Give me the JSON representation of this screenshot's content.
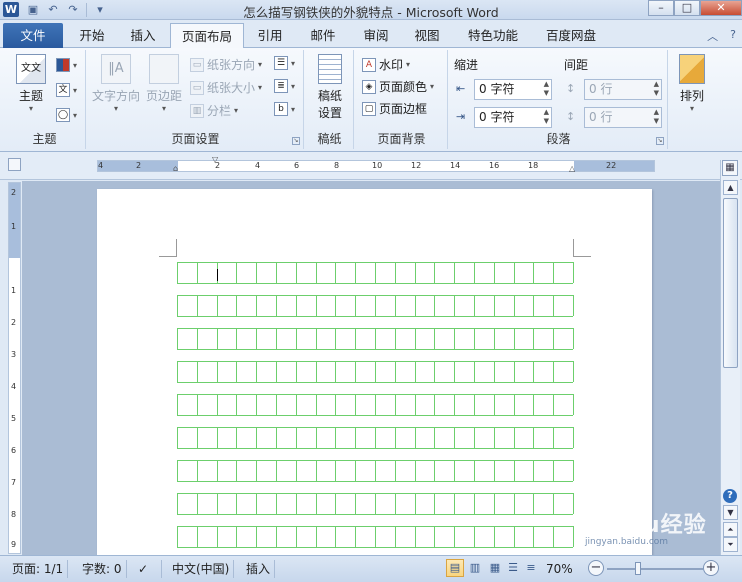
{
  "app": {
    "title": "怎么描写钢铁侠的外貌特点 - Microsoft Word",
    "logo_letter": "W"
  },
  "tabs": {
    "file": "文件",
    "items": [
      "开始",
      "插入",
      "页面布局",
      "引用",
      "邮件",
      "审阅",
      "视图",
      "特色功能",
      "百度网盘"
    ],
    "active": "页面布局"
  },
  "ribbon": {
    "theme": {
      "group_label": "主题",
      "button_label": "主题"
    },
    "page_setup": {
      "group_label": "页面设置",
      "text_direction": "文字方向",
      "margins": "页边距",
      "orientation": "纸张方向",
      "size": "纸张大小",
      "columns": "分栏"
    },
    "draft": {
      "group_label": "稿纸",
      "button_label": "稿纸\n设置",
      "line1": "稿纸",
      "line2": "设置"
    },
    "background": {
      "group_label": "页面背景",
      "watermark": "水印",
      "page_color": "页面颜色",
      "page_borders": "页面边框"
    },
    "paragraph": {
      "group_label": "段落",
      "indent_label": "缩进",
      "spacing_label": "间距",
      "indent_left": "0 字符",
      "indent_right": "0 字符",
      "spacing_before": "0 行",
      "spacing_after": "0 行"
    },
    "arrange": {
      "button_label": "排列"
    }
  },
  "ruler": {
    "h_labels": [
      "4",
      "2",
      "2",
      "4",
      "6",
      "8",
      "10",
      "12",
      "14",
      "16",
      "18",
      "22"
    ],
    "v_labels": [
      "2",
      "1",
      "1",
      "2",
      "3",
      "4",
      "5",
      "6",
      "7",
      "8",
      "9"
    ]
  },
  "status": {
    "page": "页面: 1/1",
    "words": "字数: 0",
    "language": "中文(中国)",
    "mode": "插入",
    "zoom": "70%",
    "zoom_level": 0.7
  },
  "watermark_text": "Baidu经验",
  "watermark_url": "jingyan.baidu.com",
  "colors": {
    "grid": "#6ccf6c",
    "file_tab": "#2a5a9f"
  }
}
